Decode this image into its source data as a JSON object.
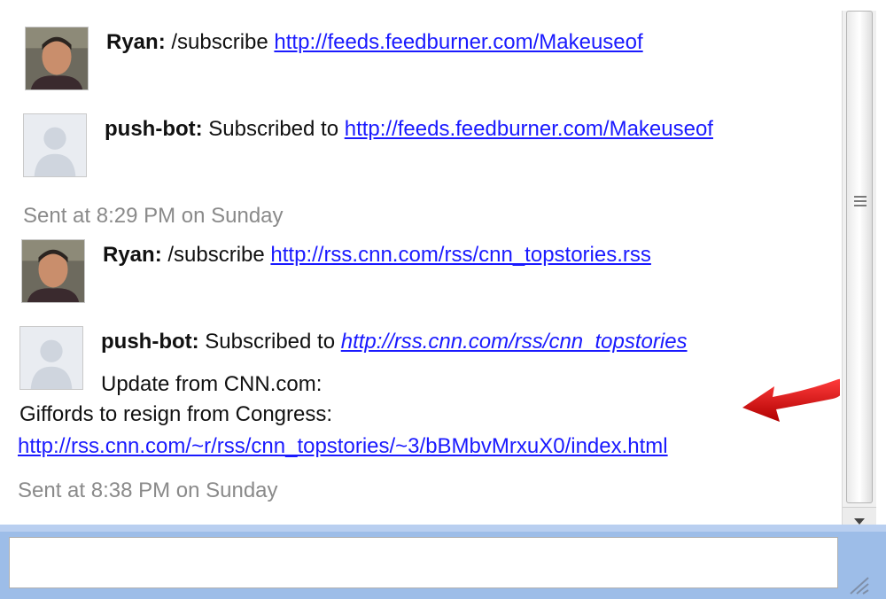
{
  "messages": [
    {
      "sender": "Ryan:",
      "text": " /subscribe ",
      "link": "http://feeds.feedburner.com/Makeuseof",
      "avatar": "user-photo"
    },
    {
      "sender": "push-bot:",
      "text": " Subscribed to ",
      "link": "http://feeds.feedburner.com/Makeuseof",
      "avatar": "default-avatar"
    },
    {
      "sender": "Ryan:",
      "text": " /subscribe ",
      "link": "http://rss.cnn.com/rss/cnn_topstories.rss",
      "avatar": "user-photo"
    },
    {
      "sender": "push-bot:",
      "text": " Subscribed to ",
      "link": "http://rss.cnn.com/rss/cnn_topstories",
      "avatar": "default-avatar"
    }
  ],
  "timestamps": [
    "Sent at 8:29 PM on Sunday",
    "Sent at 8:38 PM on Sunday"
  ],
  "update": {
    "line1": "Update from CNN.com:",
    "line2": "Giffords to resign from Congress:",
    "link": "http://rss.cnn.com/~r/rss/cnn_topstories/~3/bBMbvMrxuX0/index.html"
  },
  "input": {
    "value": ""
  },
  "colors": {
    "link": "#1a1aff",
    "timestamp": "#8a8a8a",
    "frame": "#9dbde8",
    "arrow": "#e01010"
  },
  "icons": [
    "user-photo",
    "default-avatar",
    "red-arrow-annotation",
    "scroll-down-arrow",
    "resize-grip"
  ]
}
